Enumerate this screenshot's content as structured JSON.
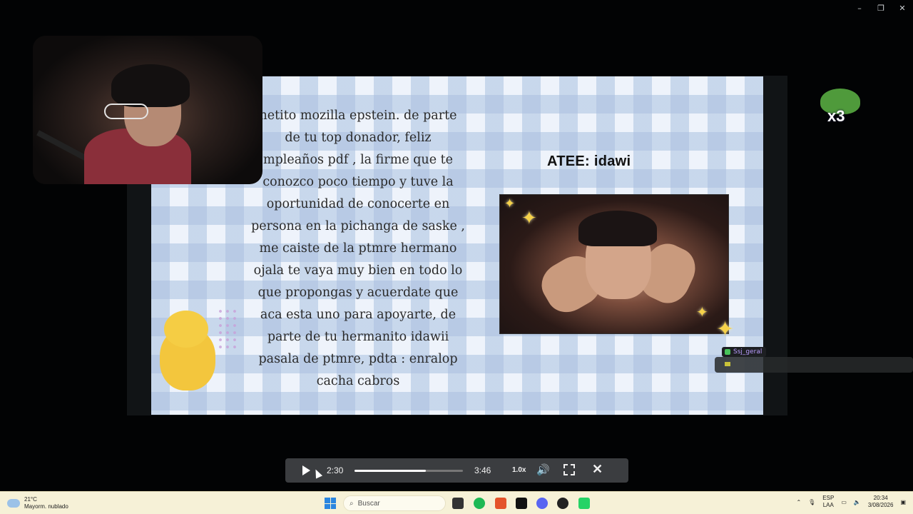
{
  "window": {
    "controls": [
      "–",
      "❐",
      "✕"
    ]
  },
  "slide": {
    "message_lines": [
      "netito mozilla epstein. de parte",
      "de tu top donador, feliz",
      "mpleaños pdf , la firme que te",
      "conozco poco tiempo y tuve la",
      "oportunidad de conocerte en",
      "persona en la pichanga de saske ,",
      "me caiste de la ptmre hermano",
      "ojala te vaya muy bien en todo lo",
      "que propongas y acuerdate que",
      "aca esta uno para apoyarte, de",
      "parte de tu hermanito idawii",
      "pasala de ptmre, pdta : enralop",
      "cacha cabros"
    ],
    "atee": "ATEE: idawi"
  },
  "badge": {
    "label": "x3"
  },
  "chat": {
    "username": "Ssj_geral"
  },
  "player": {
    "current_time": "2:30",
    "duration": "3:46",
    "progress": 0.66,
    "speed": "1.0x",
    "play_icon": "play-icon",
    "volume_icon": "volume-icon",
    "fullscreen_icon": "exit-fullscreen-icon",
    "close_icon": "close-icon"
  },
  "taskbar": {
    "weather_temp": "21°C",
    "weather_desc": "Mayorm. nublado",
    "search_placeholder": "Buscar",
    "lang_top": "ESP",
    "lang_bottom": "LAA",
    "time": "20:34",
    "date": "3/08/2026"
  }
}
